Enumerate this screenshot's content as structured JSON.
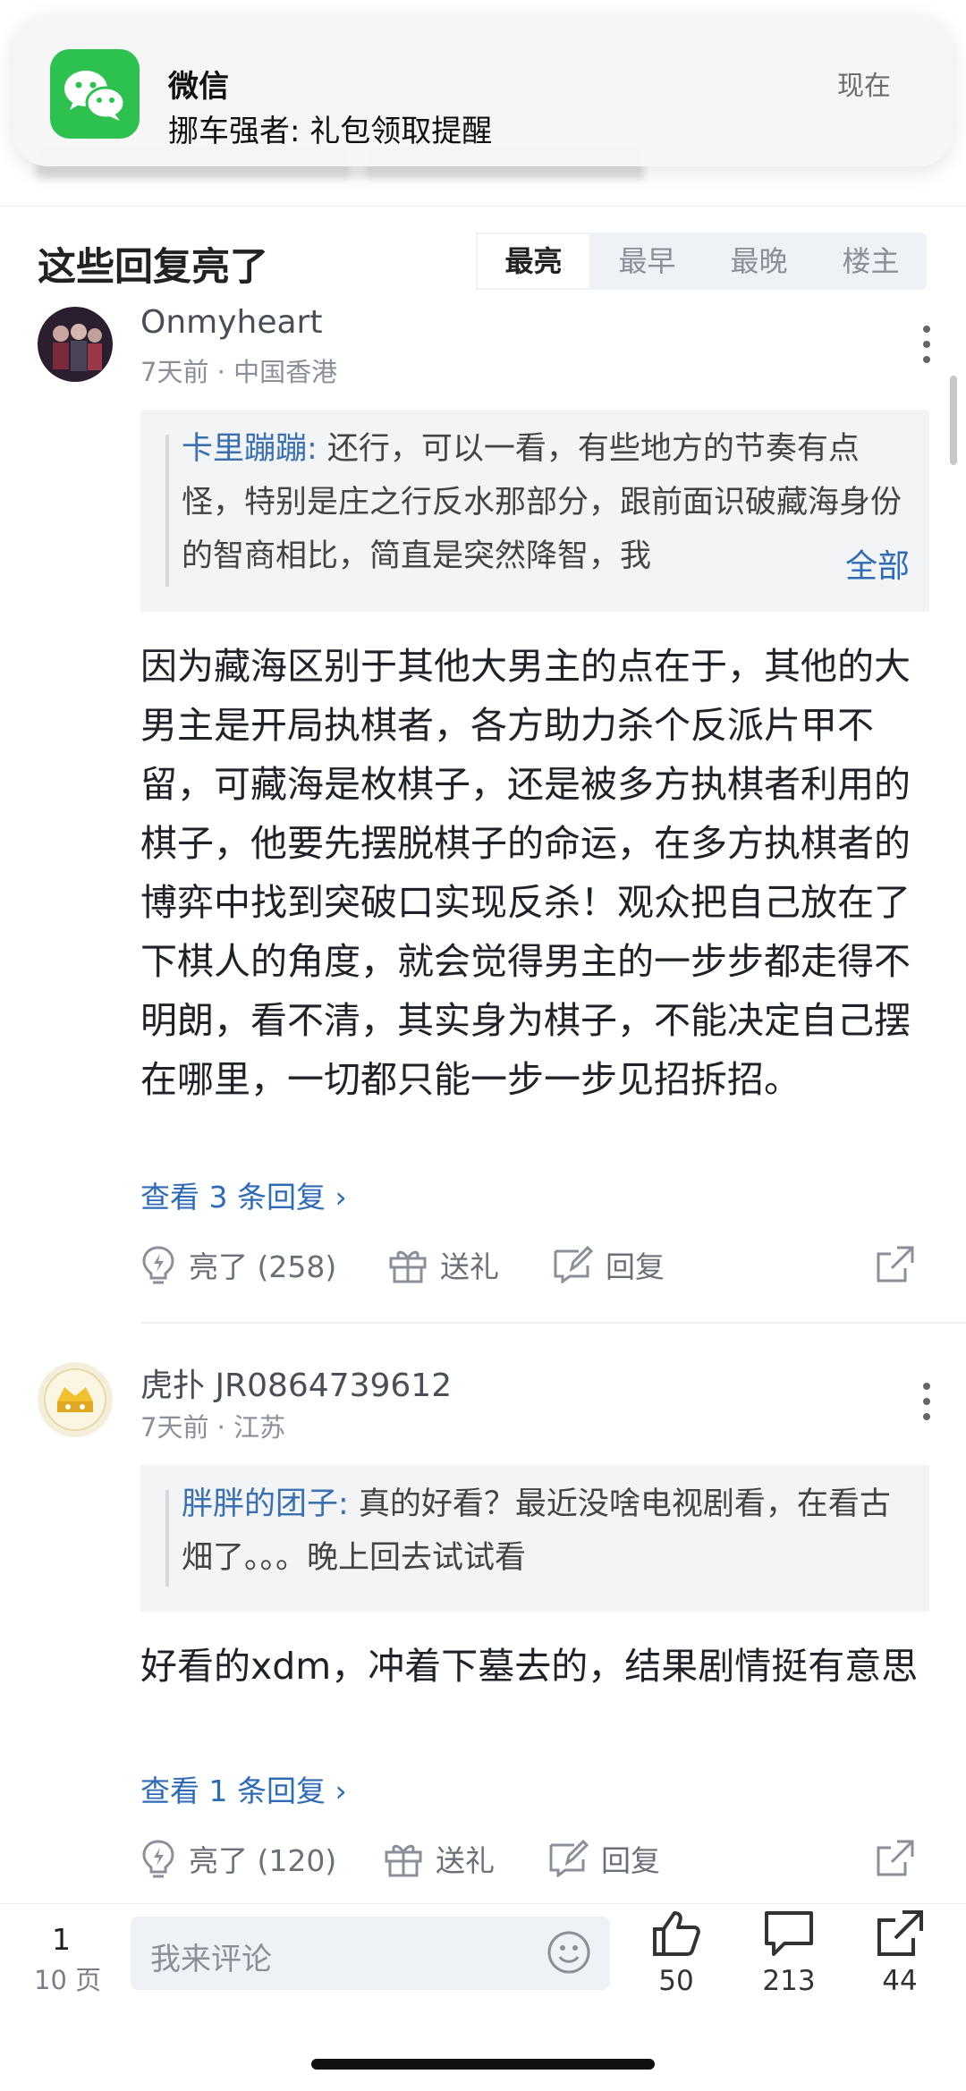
{
  "notification": {
    "app_name": "微信",
    "message": "挪车强者: 礼包领取提醒",
    "time": "现在"
  },
  "section": {
    "title": "这些回复亮了",
    "sort_tabs": [
      "最亮",
      "最早",
      "最晚",
      "楼主"
    ],
    "active_tab": "最亮"
  },
  "comments": [
    {
      "username": "Onmyheart",
      "meta": "7天前 · 中国香港",
      "quote": {
        "author": "卡里蹦蹦:",
        "text": " 还行，可以一看，有些地方的节奏有点怪，特别是庄之行反水那部分，跟前面识破藏海身份的智商相比，简直是突然降智，我",
        "more": "全部"
      },
      "body": "因为藏海区别于其他大男主的点在于，其他的大男主是开局执棋者，各方助力杀个反派片甲不留，可藏海是枚棋子，还是被多方执棋者利用的棋子，他要先摆脱棋子的命运，在多方执棋者的博弈中找到突破口实现反杀！观众把自己放在了下棋人的角度，就会觉得男主的一步步都走得不明朗，看不清，其实身为棋子，不能决定自己摆在哪里，一切都只能一步一步见招拆招。",
      "view_replies": "查看 3 条回复 ›",
      "likes": "亮了 (258)",
      "gift": "送礼",
      "reply": "回复"
    },
    {
      "username": "虎扑 JR0864739612",
      "meta": "7天前 · 江苏",
      "quote": {
        "author": "胖胖的团子:",
        "text": " 真的好看？最近没啥电视剧看，在看古畑了。。。晚上回去试试看",
        "more": ""
      },
      "body": "好看的xdm，冲着下墓去的，结果剧情挺有意思",
      "view_replies": "查看 1 条回复 ›",
      "likes": "亮了 (120)",
      "gift": "送礼",
      "reply": "回复"
    }
  ],
  "bottom_bar": {
    "page": "1",
    "total_pages": "10 页",
    "input_placeholder": "我来评论",
    "like_count": "50",
    "comment_count": "213",
    "share_count": "44"
  },
  "colors": {
    "wechat_green": "#2dc150",
    "link_blue": "#2e6bb6",
    "quote_bg": "#f3f4f6"
  }
}
